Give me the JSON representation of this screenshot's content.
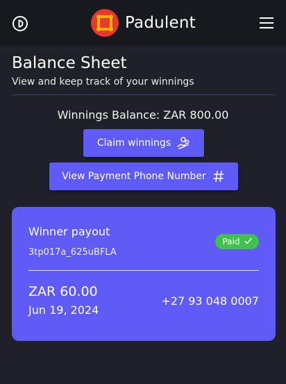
{
  "header": {
    "brand_name": "Padulent",
    "power_icon": "power-icon",
    "menu_icon": "hamburger-menu-icon",
    "logo_icon": "padulent-logo-icon",
    "logo_color": "#e8392e",
    "logo_accent": "#f5b400"
  },
  "page": {
    "title": "Balance Sheet",
    "subtitle": "View and keep track of your winnings"
  },
  "balance": {
    "text": "Winnings Balance: ZAR 800.00"
  },
  "actions": {
    "claim_label": "Claim winnings",
    "claim_icon": "hand-coins-icon",
    "phone_label": "View Payment Phone Number",
    "phone_icon": "hash-icon"
  },
  "payouts": [
    {
      "title": "Winner payout",
      "reference": "3tp017a_625uBFLA",
      "status": "Paid",
      "status_icon": "check-icon",
      "amount": "ZAR 60.00",
      "date": "Jun 19, 2024",
      "phone": "+27 93 048 0007"
    }
  ],
  "colors": {
    "background": "#1e2228",
    "header": "#16191e",
    "accent": "#5e5bf7",
    "success": "#3ec24c"
  }
}
